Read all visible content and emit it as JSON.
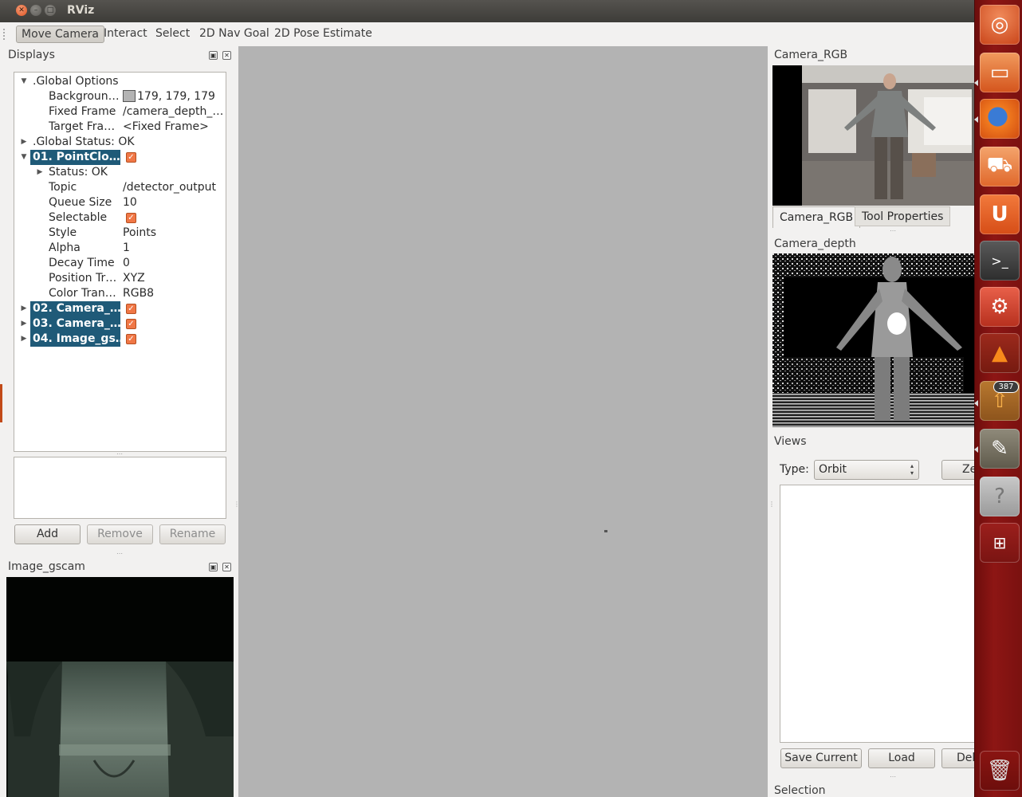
{
  "window": {
    "title": "RViz"
  },
  "toolbar": {
    "tools": [
      "Move Camera",
      "Interact",
      "Select",
      "2D Nav Goal",
      "2D Pose Estimate"
    ]
  },
  "displays": {
    "title": "Displays",
    "global_options": ".Global Options",
    "rows": {
      "background": {
        "key": "Backgroun…",
        "value": "179, 179, 179"
      },
      "fixed_frame": {
        "key": "Fixed Frame",
        "value": "/camera_depth_…"
      },
      "target_frame": {
        "key": "Target Fra…",
        "value": "<Fixed Frame>"
      }
    },
    "global_status": ".Global Status: OK",
    "pointcloud": {
      "label": "01. PointClo…",
      "status": "Status: OK",
      "props": [
        {
          "key": "Topic",
          "value": "/detector_output"
        },
        {
          "key": "Queue Size",
          "value": "10"
        },
        {
          "key": "Selectable",
          "value": ""
        },
        {
          "key": "Style",
          "value": "Points"
        },
        {
          "key": "Alpha",
          "value": "1"
        },
        {
          "key": "Decay Time",
          "value": "0"
        },
        {
          "key": "Position Tr…",
          "value": "XYZ"
        },
        {
          "key": "Color Tran…",
          "value": "RGB8"
        }
      ]
    },
    "others": [
      "02. Camera_…",
      "03. Camera_…",
      "04. Image_gs…"
    ],
    "buttons": {
      "add": "Add",
      "remove": "Remove",
      "rename": "Rename"
    }
  },
  "image_gscam": {
    "title": "Image_gscam"
  },
  "camera_rgb": {
    "title": "Camera_RGB",
    "tabs": [
      "Camera_RGB",
      "Tool Properties"
    ]
  },
  "camera_depth": {
    "title": "Camera_depth"
  },
  "views": {
    "title": "Views",
    "type_label": "Type:",
    "type_value": "Orbit",
    "zero_button": "Zero",
    "save_current": "Save Current",
    "load": "Load",
    "delete": "Delete"
  },
  "selection": {
    "title": "Selection"
  },
  "launcher": {
    "badge": "387",
    "items": [
      "ubuntu-icon",
      "files-icon",
      "firefox-icon",
      "software-center-icon",
      "ubuntu-one-icon",
      "terminal-icon",
      "system-settings-icon",
      "vlc-icon",
      "update-manager-icon",
      "gimp-icon",
      "help-icon",
      "workspace-switcher-icon",
      "trash-icon"
    ]
  },
  "colors": {
    "selection": "#1f5a78",
    "checkbox": "#f07746",
    "viewport": "#b3b3b3",
    "launcher": "#8d1614"
  }
}
